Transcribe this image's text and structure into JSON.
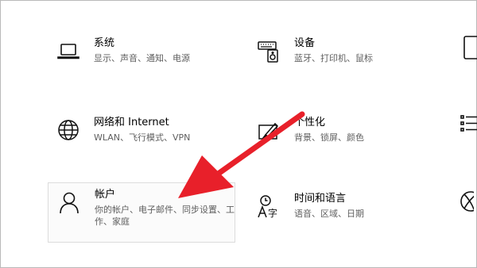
{
  "tiles": {
    "system": {
      "title": "系统",
      "desc": "显示、声音、通知、电源",
      "icon": "laptop-icon"
    },
    "devices": {
      "title": "设备",
      "desc": "蓝牙、打印机、鼠标",
      "icon": "keyboard-speaker-icon"
    },
    "network": {
      "title": "网络和 Internet",
      "desc": "WLAN、飞行模式、VPN",
      "icon": "globe-icon"
    },
    "personalization": {
      "title": "个性化",
      "desc": "背景、锁屏、颜色",
      "icon": "paint-brush-icon"
    },
    "accounts": {
      "title": "帐户",
      "desc": "你的帐户、电子邮件、同步设置、工作、家庭",
      "icon": "person-icon"
    },
    "time_language": {
      "title": "时间和语言",
      "desc": "语音、区域、日期",
      "icon": "time-language-icon"
    }
  },
  "annotation": {
    "color": "#e8202a",
    "icon": "red-arrow"
  }
}
